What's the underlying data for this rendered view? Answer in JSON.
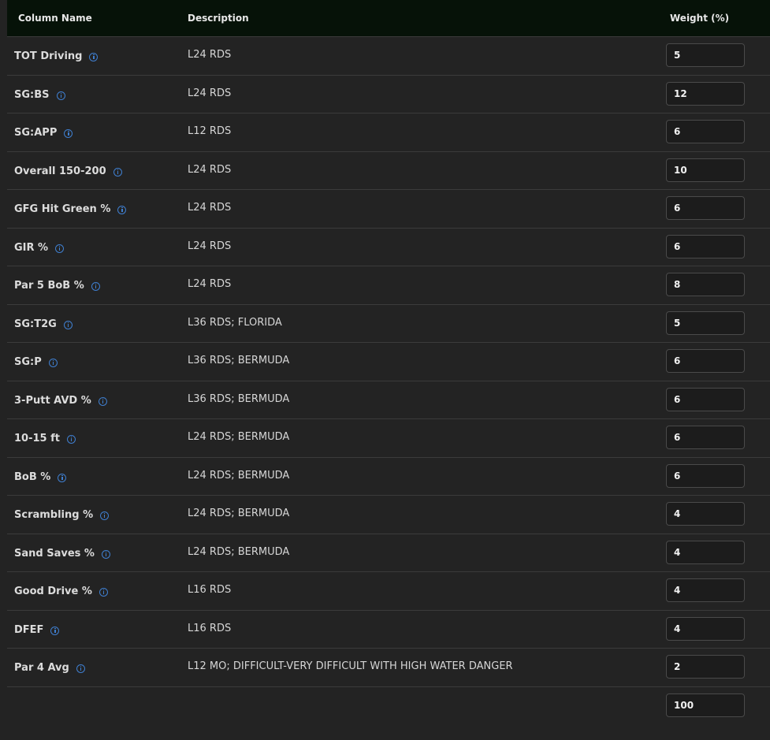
{
  "header": {
    "col_name": "Column Name",
    "col_desc": "Description",
    "col_weight": "Weight (%)"
  },
  "rows": [
    {
      "name": "TOT Driving",
      "desc": "L24 RDS",
      "weight": "5"
    },
    {
      "name": "SG:BS",
      "desc": "L24 RDS",
      "weight": "12"
    },
    {
      "name": "SG:APP",
      "desc": "L12 RDS",
      "weight": "6"
    },
    {
      "name": "Overall 150-200",
      "desc": "L24 RDS",
      "weight": "10"
    },
    {
      "name": "GFG Hit Green %",
      "desc": "L24 RDS",
      "weight": "6"
    },
    {
      "name": "GIR %",
      "desc": "L24 RDS",
      "weight": "6"
    },
    {
      "name": "Par 5 BoB %",
      "desc": "L24 RDS",
      "weight": "8"
    },
    {
      "name": "SG:T2G",
      "desc": "L36 RDS; FLORIDA",
      "weight": "5"
    },
    {
      "name": "SG:P",
      "desc": "L36 RDS; BERMUDA",
      "weight": "6"
    },
    {
      "name": "3-Putt AVD %",
      "desc": "L36 RDS; BERMUDA",
      "weight": "6"
    },
    {
      "name": "10-15 ft",
      "desc": "L24 RDS; BERMUDA",
      "weight": "6"
    },
    {
      "name": "BoB %",
      "desc": "L24 RDS; BERMUDA",
      "weight": "6"
    },
    {
      "name": "Scrambling %",
      "desc": "L24 RDS; BERMUDA",
      "weight": "4"
    },
    {
      "name": "Sand Saves %",
      "desc": "L24 RDS; BERMUDA",
      "weight": "4"
    },
    {
      "name": "Good Drive %",
      "desc": "L16 RDS",
      "weight": "4"
    },
    {
      "name": "DFEF",
      "desc": "L16 RDS",
      "weight": "4"
    },
    {
      "name": "Par 4 Avg",
      "desc": "L12 MO; DIFFICULT-VERY DIFFICULT WITH HIGH WATER DANGER",
      "weight": "2"
    }
  ],
  "total": "100",
  "colors": {
    "background": "#232323",
    "header_bg": "#061208",
    "info_icon": "#3f7fd0"
  }
}
